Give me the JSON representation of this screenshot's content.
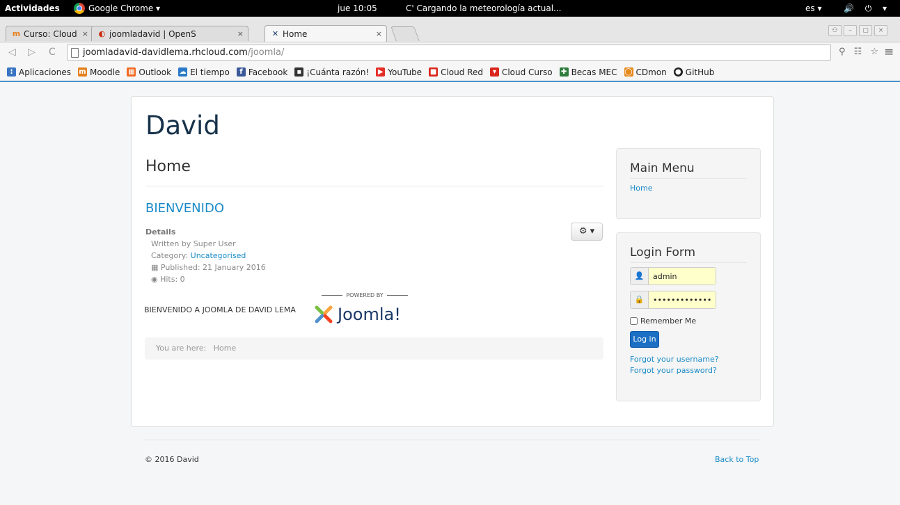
{
  "system_bar": {
    "activities": "Actividades",
    "app_name": "Google Chrome ▾",
    "clock": "jue 10:05",
    "loading": "C' Cargando la meteorología actual...",
    "lang": "es ▾",
    "icons": "🔊 ⏻ ▾"
  },
  "tabs": [
    {
      "favicon": "m",
      "favicon_color": "#e5801e",
      "title": "Curso: Cloud Compu",
      "close": "×"
    },
    {
      "favicon": "◐",
      "favicon_color": "#cc2200",
      "title": "joomladavid | OpenS",
      "close": "×"
    },
    {
      "favicon": "✕",
      "favicon_color": "#1a3867",
      "title": "Home",
      "close": "×"
    }
  ],
  "address_bar": {
    "host": "joomladavid-davidlema.rhcloud.com",
    "path": "/joomla/",
    "back": "◁",
    "forward": "▷",
    "reload": "C",
    "right_icons": "⚲ ☷ ☆",
    "menu": "≡"
  },
  "bookmarks": [
    {
      "label": "Aplicaciones",
      "icon": "⁞",
      "color": "#3a75c4"
    },
    {
      "label": "Moodle",
      "icon": "m",
      "color": "#e5801e"
    },
    {
      "label": "Outlook",
      "icon": "▦",
      "color": "#f06a22"
    },
    {
      "label": "El tiempo",
      "icon": "☁",
      "color": "#2b7ac7"
    },
    {
      "label": "Facebook",
      "icon": "f",
      "color": "#3b5998"
    },
    {
      "label": "¡Cuánta razón!",
      "icon": "▪",
      "color": "#333333"
    },
    {
      "label": "YouTube",
      "icon": "▶",
      "color": "#e52d27"
    },
    {
      "label": "Cloud Red",
      "icon": "■",
      "color": "#d9261c"
    },
    {
      "label": "Cloud Curso",
      "icon": "▾",
      "color": "#d9261c"
    },
    {
      "label": "Becas MEC",
      "icon": "✚",
      "color": "#2f7d3c"
    },
    {
      "label": "CDmon",
      "icon": "◯",
      "color": "#e58a1e"
    },
    {
      "label": "GitHub",
      "icon": "●",
      "color": "#222222"
    }
  ],
  "site": {
    "title": "David",
    "page_heading": "Home",
    "article_title": "BIENVENIDO",
    "gear": "⚙ ▾",
    "details_label": "Details",
    "written_by": "Written by Super User",
    "category_label": "Category: ",
    "category_link": "Uncategorised",
    "published": "Published: 21 January 2016",
    "hits": "Hits: 0",
    "body": "BIENVENIDO A JOOMLA DE DAVID LEMA",
    "powered_by": "POWERED BY",
    "joomla_word": "Joomla!",
    "breadcrumb_label": "You are here:",
    "breadcrumb_current": "Home"
  },
  "main_menu": {
    "title": "Main Menu",
    "items": [
      "Home"
    ]
  },
  "login": {
    "title": "Login Form",
    "username": "admin",
    "password": "••••••••••••••••",
    "remember": "Remember Me",
    "button": "Log in",
    "forgot_username": "Forgot your username?",
    "forgot_password": "Forgot your password?"
  },
  "footer": {
    "copyright": "© 2016 David",
    "back_to_top": "Back to Top"
  }
}
